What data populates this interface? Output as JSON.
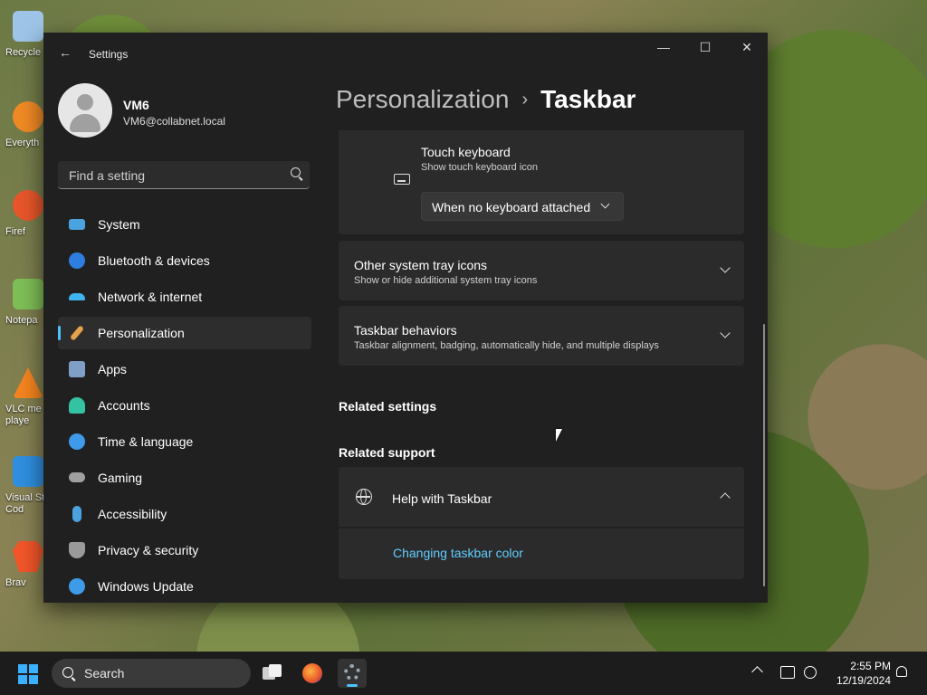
{
  "desktop": {
    "icons": [
      {
        "label": "Recycle",
        "color": "#9ec5e8"
      },
      {
        "label": "Everyth",
        "color": "#f08a24"
      },
      {
        "label": "Firef",
        "color": "#e8562b"
      },
      {
        "label": "Notepa",
        "color": "#7fbf57"
      },
      {
        "label": "VLC me\nplaye",
        "color": "#f5841f"
      },
      {
        "label": "Visual St\nCod",
        "color": "#2f8fe0"
      },
      {
        "label": "Brav",
        "color": "#f2562a"
      }
    ]
  },
  "window": {
    "app_title": "Settings",
    "controls": {
      "minimize": "—",
      "maximize": "☐",
      "close": "✕"
    }
  },
  "profile": {
    "name": "VM6",
    "email": "VM6@collabnet.local"
  },
  "search": {
    "placeholder": "Find a setting"
  },
  "nav": {
    "items": [
      {
        "label": "System",
        "icon": "monitor-icon",
        "color": "#4aa3df"
      },
      {
        "label": "Bluetooth & devices",
        "icon": "bluetooth-icon",
        "color": "#2f7de0"
      },
      {
        "label": "Network & internet",
        "icon": "wifi-icon",
        "color": "#3fb4f0"
      },
      {
        "label": "Personalization",
        "icon": "brush-icon",
        "color": "#e3a24b",
        "active": true
      },
      {
        "label": "Apps",
        "icon": "apps-icon",
        "color": "#7f9fc7"
      },
      {
        "label": "Accounts",
        "icon": "person-icon",
        "color": "#35c2a3"
      },
      {
        "label": "Time & language",
        "icon": "globe-clock-icon",
        "color": "#3d9be9"
      },
      {
        "label": "Gaming",
        "icon": "gamepad-icon",
        "color": "#a0a0a0"
      },
      {
        "label": "Accessibility",
        "icon": "accessibility-icon",
        "color": "#4aa3df"
      },
      {
        "label": "Privacy & security",
        "icon": "shield-icon",
        "color": "#9a9a9a"
      },
      {
        "label": "Windows Update",
        "icon": "update-icon",
        "color": "#3d9be9"
      }
    ]
  },
  "breadcrumb": {
    "parent": "Personalization",
    "separator": "›",
    "current": "Taskbar"
  },
  "touch_keyboard": {
    "title": "Touch keyboard",
    "subtitle": "Show touch keyboard icon",
    "dropdown_value": "When no keyboard attached"
  },
  "other_tray": {
    "title": "Other system tray icons",
    "subtitle": "Show or hide additional system tray icons"
  },
  "behaviors": {
    "title": "Taskbar behaviors",
    "subtitle": "Taskbar alignment, badging, automatically hide, and multiple displays"
  },
  "related_settings": {
    "heading": "Related settings"
  },
  "related_support": {
    "heading": "Related support",
    "help_title": "Help with Taskbar",
    "link": "Changing taskbar color"
  },
  "taskbar": {
    "search_label": "Search",
    "time": "2:55 PM",
    "date": "12/19/2024",
    "accent": "#4cc2ff"
  }
}
